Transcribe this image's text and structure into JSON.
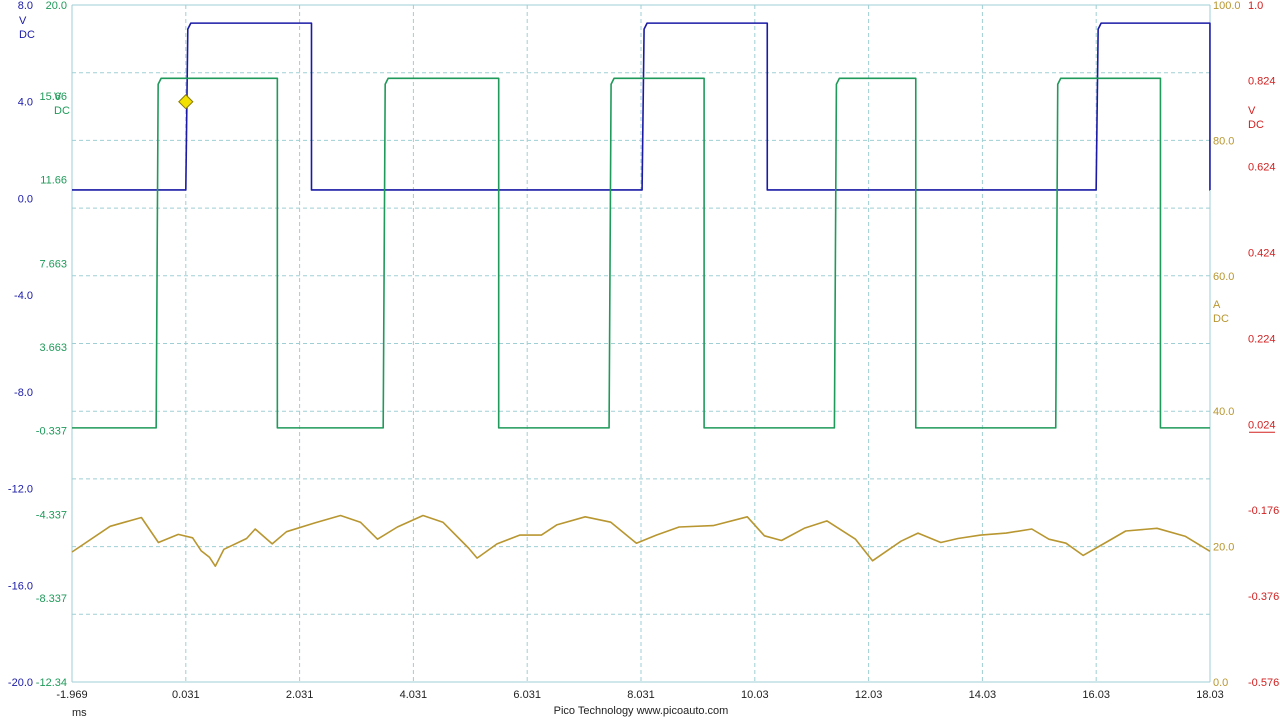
{
  "footer": {
    "x_unit": "ms",
    "brand": "Pico Technology  www.picoauto.com"
  },
  "colors": {
    "blue": "#1a1aa6",
    "green": "#1f9a5a",
    "red": "#d42020",
    "gold": "#b89630",
    "grid": "#9fcfd4",
    "trigger": "#f2e000"
  },
  "chart_data": {
    "type": "line",
    "x_axis": {
      "unit": "ms",
      "range": [
        -1.969,
        18.031
      ],
      "ticks": [
        "-1.969",
        "0.031",
        "2.031",
        "4.031",
        "6.031",
        "8.031",
        "10.03",
        "12.03",
        "14.03",
        "16.03",
        "18.03"
      ]
    },
    "axes": [
      {
        "id": "A",
        "color": "blue",
        "unit": "V",
        "coupling": "DC",
        "range": [
          -20,
          8
        ],
        "ticks": [
          "8.0",
          "4.0",
          "0.0",
          "-4.0",
          "-8.0",
          "-12.0",
          "-16.0",
          "-20.0"
        ]
      },
      {
        "id": "B",
        "color": "green",
        "unit": "V",
        "coupling": "DC",
        "range": [
          -12.34,
          20.0
        ],
        "ticks": [
          "20.0",
          "15.66",
          "11.66",
          "7.663",
          "3.663",
          "-0.337",
          "-4.337",
          "-8.337",
          "-12.34"
        ]
      },
      {
        "id": "C",
        "color": "red",
        "unit": "V",
        "coupling": "DC",
        "range": [
          -0.576,
          1.0
        ],
        "ticks": [
          "1.0",
          "0.824",
          "0.624",
          "0.424",
          "0.224",
          "0.024",
          "-0.176",
          "-0.376",
          "-0.576"
        ]
      },
      {
        "id": "D",
        "color": "gold",
        "unit": "A",
        "coupling": "DC",
        "range": [
          0,
          100
        ],
        "ticks": [
          "100.0",
          "80.0",
          "60.0",
          "40.0",
          "20.0",
          "0.0"
        ]
      }
    ],
    "trigger": {
      "x": 0.031,
      "y": 4.0,
      "axis": "A"
    },
    "series": [
      {
        "axis": "A",
        "color": "blue",
        "low": 0.35,
        "high": 7.25,
        "pulses": [
          [
            0.031,
            2.24
          ],
          [
            8.05,
            10.25
          ],
          [
            16.03,
            18.03
          ]
        ]
      },
      {
        "axis": "B",
        "color": "green",
        "low": -0.2,
        "high": 16.5,
        "pulses": [
          [
            -0.49,
            1.64
          ],
          [
            3.5,
            5.53
          ],
          [
            7.47,
            9.14
          ],
          [
            11.43,
            12.86
          ],
          [
            15.32,
            17.16
          ]
        ]
      },
      {
        "axis": "D",
        "color": "gold",
        "points": [
          [
            -1.969,
            19.2
          ],
          [
            -1.3,
            23.0
          ],
          [
            -0.75,
            24.3
          ],
          [
            -0.45,
            20.6
          ],
          [
            -0.1,
            21.8
          ],
          [
            0.15,
            21.3
          ],
          [
            0.3,
            19.4
          ],
          [
            0.45,
            18.4
          ],
          [
            0.55,
            17.1
          ],
          [
            0.7,
            19.6
          ],
          [
            1.1,
            21.2
          ],
          [
            1.25,
            22.6
          ],
          [
            1.55,
            20.4
          ],
          [
            1.8,
            22.2
          ],
          [
            2.3,
            23.5
          ],
          [
            2.75,
            24.6
          ],
          [
            3.1,
            23.6
          ],
          [
            3.4,
            21.1
          ],
          [
            3.75,
            22.9
          ],
          [
            4.2,
            24.6
          ],
          [
            4.55,
            23.6
          ],
          [
            5.0,
            19.8
          ],
          [
            5.15,
            18.3
          ],
          [
            5.5,
            20.4
          ],
          [
            5.9,
            21.7
          ],
          [
            6.28,
            21.7
          ],
          [
            6.55,
            23.2
          ],
          [
            7.05,
            24.4
          ],
          [
            7.5,
            23.6
          ],
          [
            7.95,
            20.5
          ],
          [
            8.3,
            21.7
          ],
          [
            8.7,
            22.9
          ],
          [
            9.3,
            23.1
          ],
          [
            9.9,
            24.4
          ],
          [
            10.2,
            21.6
          ],
          [
            10.5,
            20.9
          ],
          [
            10.9,
            22.7
          ],
          [
            11.3,
            23.8
          ],
          [
            11.8,
            21.1
          ],
          [
            12.1,
            17.9
          ],
          [
            12.6,
            20.8
          ],
          [
            12.9,
            22.0
          ],
          [
            13.3,
            20.6
          ],
          [
            13.6,
            21.2
          ],
          [
            14.0,
            21.7
          ],
          [
            14.45,
            22.0
          ],
          [
            14.9,
            22.6
          ],
          [
            15.2,
            21.1
          ],
          [
            15.5,
            20.5
          ],
          [
            15.8,
            18.7
          ],
          [
            16.2,
            20.6
          ],
          [
            16.55,
            22.3
          ],
          [
            17.1,
            22.7
          ],
          [
            17.6,
            21.5
          ],
          [
            18.031,
            19.3
          ]
        ]
      }
    ]
  }
}
